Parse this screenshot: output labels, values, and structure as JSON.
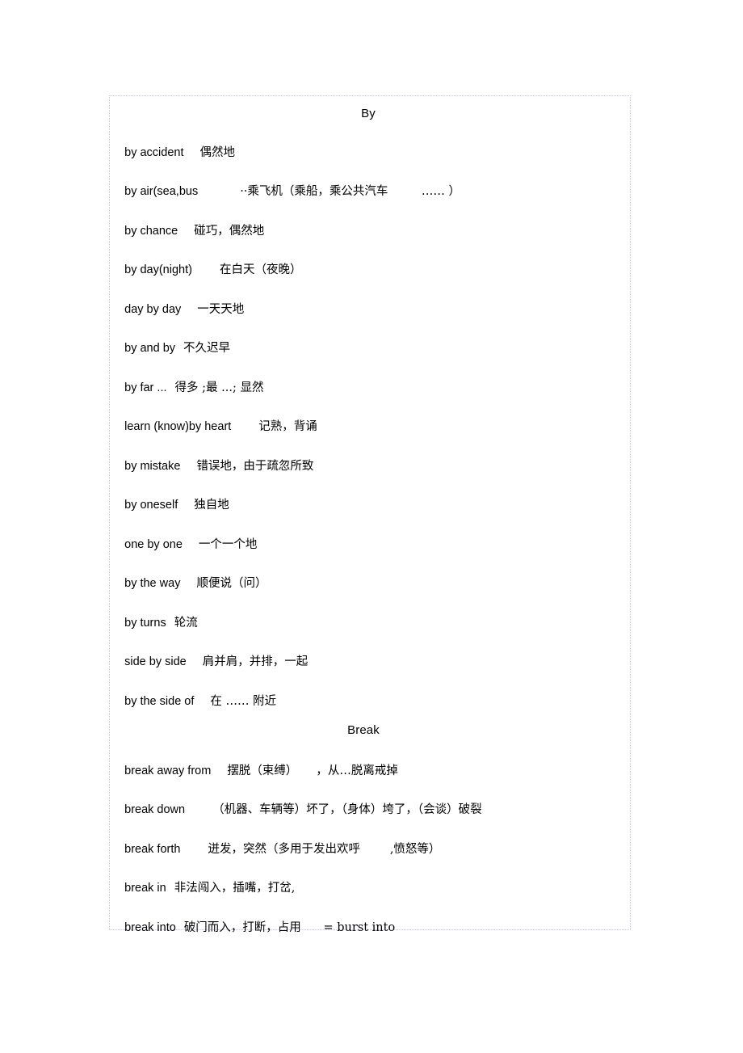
{
  "document": {
    "sections": [
      {
        "heading": "By",
        "entries": [
          {
            "term": "by accident",
            "gap": "gap-md",
            "gloss": "偶然地"
          },
          {
            "term": "by air(sea,bus",
            "gap": "gap-xl",
            "gloss": "··乘飞机（乘船，乘公共汽车         …… ）"
          },
          {
            "term": "by chance",
            "gap": "gap-md",
            "gloss": "碰巧，偶然地"
          },
          {
            "term": "by day(night)",
            "gap": "gap-lg",
            "gloss": "在白天（夜晚）"
          },
          {
            "term": "day by day",
            "gap": "gap-md",
            "gloss": "一天天地"
          },
          {
            "term": "by and by",
            "gap": "gap-sm",
            "gloss": "不久迟早"
          },
          {
            "term": "by far ...",
            "gap": "gap-sm",
            "gloss": "得多 ;最 ...; 显然"
          },
          {
            "term": "learn (know)by heart",
            "gap": "gap-lg",
            "gloss": "记熟，背诵"
          },
          {
            "term": "by mistake",
            "gap": "gap-md",
            "gloss": "错误地，由于疏忽所致"
          },
          {
            "term": "by oneself",
            "gap": "gap-md",
            "gloss": "独自地"
          },
          {
            "term": "one by one",
            "gap": "gap-md",
            "gloss": "一个一个地"
          },
          {
            "term": "by the way",
            "gap": "gap-md",
            "gloss": "顺便说（问）"
          },
          {
            "term": "by turns",
            "gap": "gap-sm",
            "gloss": "轮流"
          },
          {
            "term": "side by side",
            "gap": "gap-md",
            "gloss": "肩并肩，并排，一起"
          },
          {
            "term": "by the side of",
            "gap": "gap-md",
            "gloss": "在 …… 附近"
          }
        ]
      },
      {
        "heading": "Break",
        "entries": [
          {
            "term": "break away from",
            "gap": "gap-md",
            "gloss": "摆脱（束缚）     ，从…脱离戒掉"
          },
          {
            "term": "break down",
            "gap": "gap-lg",
            "gloss": "（机器、车辆等）坏了，（身体）垮了，（会谈）破裂"
          },
          {
            "term": "break forth",
            "gap": "gap-lg",
            "gloss": "迸发，突然（多用于发出欢呼        ,愤怒等）"
          },
          {
            "term": "break in",
            "gap": "gap-sm",
            "gloss": "非法闯入，插嘴，打岔,"
          },
          {
            "term": "break into",
            "gap": "gap-sm",
            "gloss": "破门而入，打断，占用      = burst into"
          }
        ]
      }
    ]
  },
  "colors": {
    "page_background": "#ffffff",
    "text": "#000000",
    "frame_border": "#c9c9d2"
  }
}
